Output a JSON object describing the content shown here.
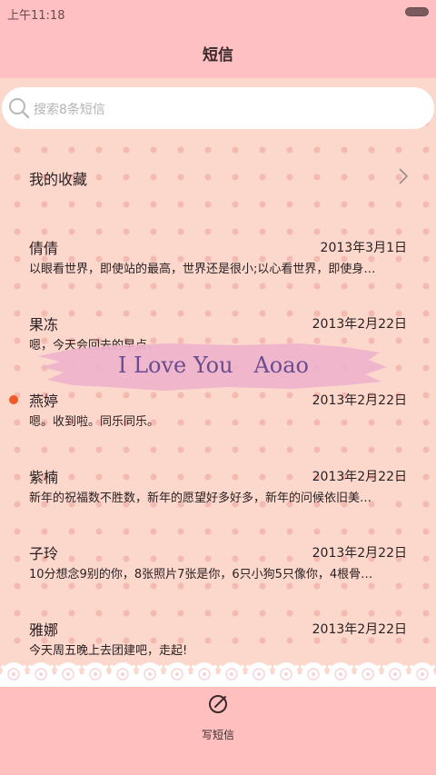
{
  "status_bar": {
    "time": "上午11:18"
  },
  "header": {
    "title": "短信"
  },
  "search": {
    "placeholder": "搜索8条短信"
  },
  "favorites": {
    "label": "我的收藏"
  },
  "banner": {
    "text": "I Love You   Aoao"
  },
  "messages": [
    {
      "sender": "倩倩",
      "date": "2013年3月1日",
      "preview": "以眼看世界，即使站的最高，世界还是很小;以心看世界，即使身…",
      "unread": false
    },
    {
      "sender": "果冻",
      "date": "2013年2月22日",
      "preview": "嗯，今天会回去的早点。",
      "unread": false
    },
    {
      "sender": "燕婷",
      "date": "2013年2月22日",
      "preview": "嗯。收到啦。同乐同乐。",
      "unread": true
    },
    {
      "sender": "紫楠",
      "date": "2013年2月22日",
      "preview": "新年的祝福数不胜数，新年的愿望好多好多，新年的问候依旧美…",
      "unread": false
    },
    {
      "sender": "子玲",
      "date": "2013年2月22日",
      "preview": "10分想念9别的你，8张照片7张是你，6只小狗5只像你，4根骨…",
      "unread": false
    },
    {
      "sender": "雅娜",
      "date": "2013年2月22日",
      "preview": "今天周五晚上去团建吧，走起!",
      "unread": false
    }
  ],
  "bottom_bar": {
    "compose_label": "写短信"
  },
  "colors": {
    "accent_pink": "#ffbfbf",
    "unread_dot": "#f05a28",
    "banner_text": "#6a4d8f"
  },
  "icons": {
    "search": "search-icon",
    "chevron": "chevron-right-icon",
    "compose": "compose-icon",
    "battery": "battery-icon"
  }
}
